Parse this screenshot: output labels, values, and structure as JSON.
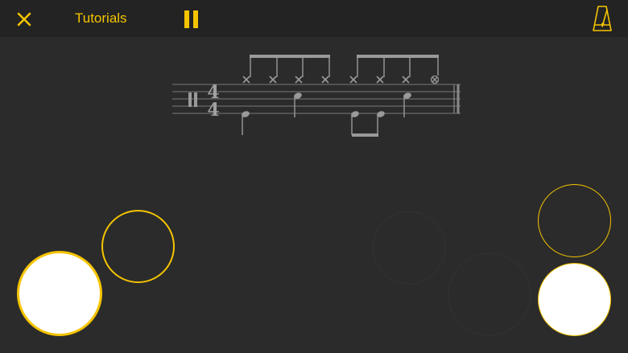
{
  "header": {
    "close_icon": "close-icon",
    "tutorials_label": "Tutorials",
    "pause_icon": "pause-icon",
    "metronome_icon": "metronome-icon",
    "accent_color": "#f5c400"
  },
  "score": {
    "time_signature_top": "4",
    "time_signature_bottom": "4",
    "clef_icon": "percussion-clef-icon"
  },
  "pads": {
    "colors": {
      "filled": "#ffffff",
      "outline": "#f5c400",
      "background": "#2b2b2b"
    }
  }
}
